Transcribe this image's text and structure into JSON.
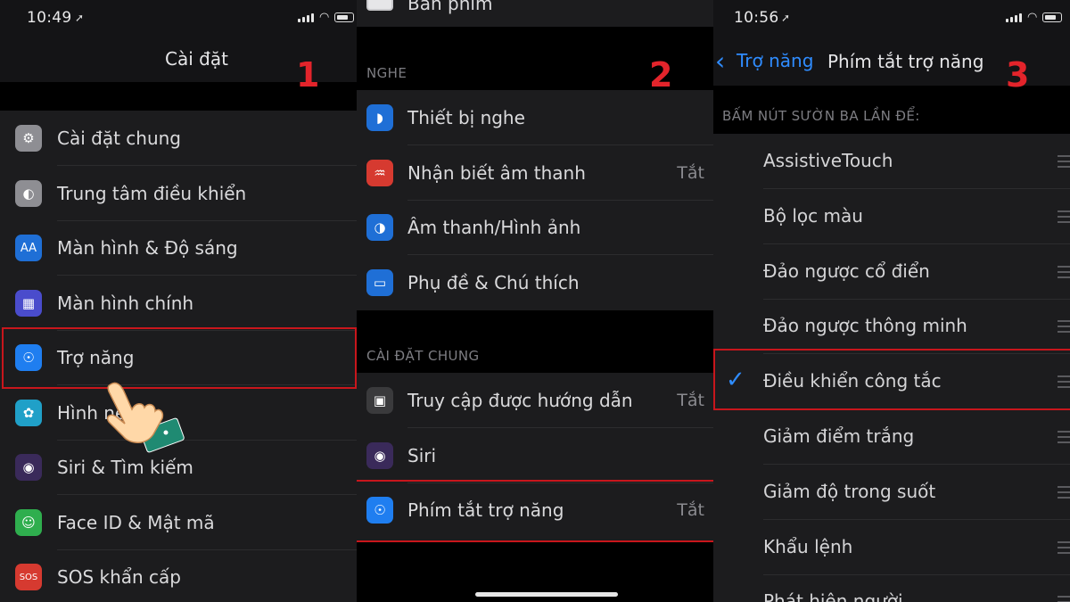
{
  "panels": {
    "one": {
      "time": "10:49",
      "title": "Cài đặt",
      "step": "1",
      "items": [
        {
          "label": "Cài đặt chung",
          "icon": "gear-icon",
          "color": "#8e8e93"
        },
        {
          "label": "Trung tâm điều khiển",
          "icon": "toggles-icon",
          "color": "#8e8e93"
        },
        {
          "label": "Màn hình & Độ sáng",
          "icon": "text-size-icon",
          "color": "#1f6fd6"
        },
        {
          "label": "Màn hình chính",
          "icon": "home-grid-icon",
          "color": "#4a4ccc"
        },
        {
          "label": "Trợ năng",
          "icon": "accessibility-icon",
          "color": "#1f7ef0"
        },
        {
          "label": "Hình nền",
          "icon": "wallpaper-icon",
          "color": "#20a0c8"
        },
        {
          "label": "Siri & Tìm kiếm",
          "icon": "siri-icon",
          "color": "#3a2a5a"
        },
        {
          "label": "Face ID & Mật mã",
          "icon": "face-id-icon",
          "color": "#2fae4e"
        },
        {
          "label": "SOS khẩn cấp",
          "icon": "sos-icon",
          "color": "#d63a30"
        }
      ]
    },
    "two": {
      "top_item": "Bàn phím",
      "step": "2",
      "section_hearing": "NGHE",
      "hearing_items": [
        {
          "label": "Thiết bị nghe",
          "icon": "ear-icon",
          "color": "#1f6fd6",
          "value": ""
        },
        {
          "label": "Nhận biết âm thanh",
          "icon": "sound-recognition-icon",
          "color": "#d63a30",
          "value": "Tắt"
        },
        {
          "label": "Âm thanh/Hình ảnh",
          "icon": "audio-visual-icon",
          "color": "#1f6fd6",
          "value": ""
        },
        {
          "label": "Phụ đề & Chú thích",
          "icon": "subtitles-icon",
          "color": "#1f6fd6",
          "value": ""
        }
      ],
      "section_general": "CÀI ĐẶT CHUNG",
      "general_items": [
        {
          "label": "Truy cập được hướng dẫn",
          "icon": "lock-icon",
          "color": "#3a3a3c",
          "value": "Tắt"
        },
        {
          "label": "Siri",
          "icon": "siri-icon",
          "color": "#3a2a5a",
          "value": ""
        },
        {
          "label": "Phím tắt trợ năng",
          "icon": "accessibility-icon",
          "color": "#1f7ef0",
          "value": "Tắt"
        }
      ]
    },
    "three": {
      "time": "10:56",
      "back_label": "Trợ năng",
      "title": "Phím tắt trợ năng",
      "step": "3",
      "section": "BẤM NÚT SƯỜN BA LẦN ĐỂ:",
      "options": [
        {
          "label": "AssistiveTouch",
          "checked": false
        },
        {
          "label": "Bộ lọc màu",
          "checked": false
        },
        {
          "label": "Đảo ngược cổ điển",
          "checked": false
        },
        {
          "label": "Đảo ngược thông minh",
          "checked": false
        },
        {
          "label": "Điều khiển công tắc",
          "checked": true
        },
        {
          "label": "Giảm điểm trắng",
          "checked": false
        },
        {
          "label": "Giảm độ trong suốt",
          "checked": false
        },
        {
          "label": "Khẩu lệnh",
          "checked": false
        },
        {
          "label": "Phát hiện người",
          "checked": false
        }
      ]
    }
  },
  "colors": {
    "highlight": "#c8161c",
    "step_number": "#e3242b",
    "ios_blue": "#2f8cff"
  }
}
